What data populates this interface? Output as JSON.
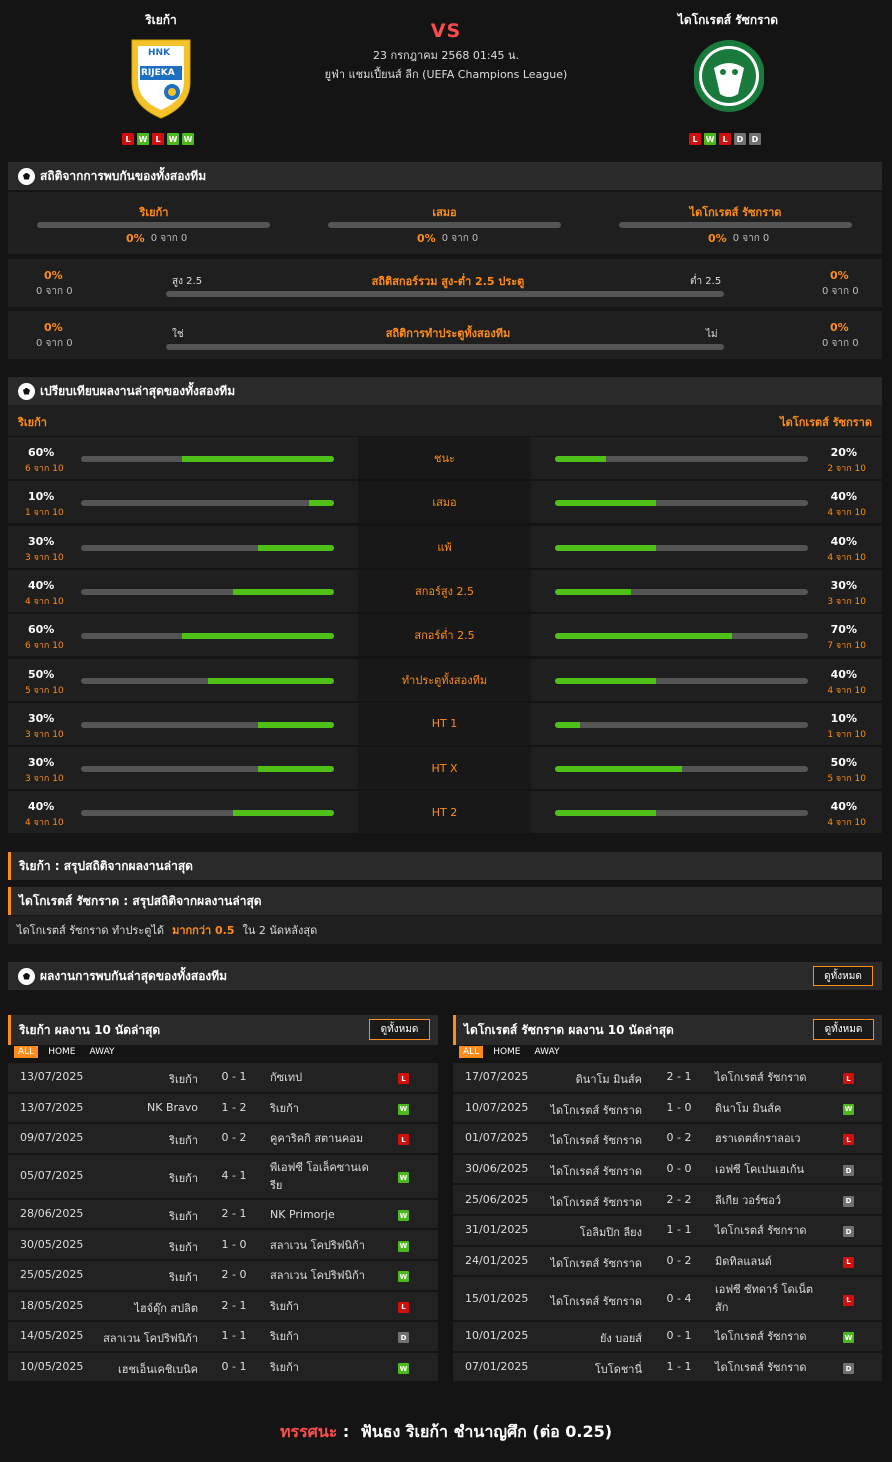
{
  "match": {
    "home": "ริเยก้า",
    "away": "ไดโกเรตส์ รัซกราด",
    "vs": "VS",
    "date": "23 กรกฎาคม 2568 01:45 น.",
    "league": "ยูฟ่า แชมเปี้ยนส์ ลีก (UEFA Champions League)",
    "home_logo_text": "RIJEKA",
    "home_logo_top": "HNK",
    "home_form": [
      "L",
      "W",
      "L",
      "W",
      "W"
    ],
    "away_form": [
      "L",
      "W",
      "L",
      "D",
      "D"
    ]
  },
  "h2h_stats": {
    "title": "สถิติจากการพบกันของทั้งสองทีม",
    "cols": [
      {
        "label": "ริเยก้า",
        "pct": "0%",
        "sub": "0 จาก 0"
      },
      {
        "label": "เสมอ",
        "pct": "0%",
        "sub": "0 จาก 0"
      },
      {
        "label": "ไดโกเรตส์ รัซกราด",
        "pct": "0%",
        "sub": "0 จาก 0"
      }
    ],
    "goals": {
      "label": "สถิติสกอร์รวม สูง-ต่ำ 2.5 ประตู",
      "left_pct": "0%",
      "left_sub": "0 จาก 0",
      "right_pct": "0%",
      "right_sub": "0 จาก 0",
      "left_tag": "สูง 2.5",
      "right_tag": "ต่ำ 2.5"
    },
    "btts": {
      "label": "สถิติการทำประตูทั้งสองทีม",
      "left_pct": "0%",
      "left_sub": "0 จาก 0",
      "right_pct": "0%",
      "right_sub": "0 จาก 0",
      "left_tag": "ใช่",
      "right_tag": "ไม่"
    }
  },
  "compare": {
    "title": "เปรียบเทียบผลงานล่าสุดของทั้งสองทีม",
    "home": "ริเยก้า",
    "away": "ไดโกเรตส์ รัซกราด",
    "rows": [
      {
        "label": "ชนะ",
        "lp": "60%",
        "ls": "6 จาก 10",
        "lv": 0.6,
        "rp": "20%",
        "rs": "2 จาก 10",
        "rv": 0.2
      },
      {
        "label": "เสมอ",
        "lp": "10%",
        "ls": "1 จาก 10",
        "lv": 0.1,
        "rp": "40%",
        "rs": "4 จาก 10",
        "rv": 0.4
      },
      {
        "label": "แพ้",
        "lp": "30%",
        "ls": "3 จาก 10",
        "lv": 0.3,
        "rp": "40%",
        "rs": "4 จาก 10",
        "rv": 0.4
      },
      {
        "label": "สกอร์สูง 2.5",
        "lp": "40%",
        "ls": "4 จาก 10",
        "lv": 0.4,
        "rp": "30%",
        "rs": "3 จาก 10",
        "rv": 0.3
      },
      {
        "label": "สกอร์ต่ำ 2.5",
        "lp": "60%",
        "ls": "6 จาก 10",
        "lv": 0.6,
        "rp": "70%",
        "rs": "7 จาก 10",
        "rv": 0.7
      },
      {
        "label": "ทำประตูทั้งสองทีม",
        "lp": "50%",
        "ls": "5 จาก 10",
        "lv": 0.5,
        "rp": "40%",
        "rs": "4 จาก 10",
        "rv": 0.4
      },
      {
        "label": "HT 1",
        "lp": "30%",
        "ls": "3 จาก 10",
        "lv": 0.3,
        "rp": "10%",
        "rs": "1 จาก 10",
        "rv": 0.1
      },
      {
        "label": "HT X",
        "lp": "30%",
        "ls": "3 จาก 10",
        "lv": 0.3,
        "rp": "50%",
        "rs": "5 จาก 10",
        "rv": 0.5
      },
      {
        "label": "HT 2",
        "lp": "40%",
        "ls": "4 จาก 10",
        "lv": 0.4,
        "rp": "40%",
        "rs": "4 จาก 10",
        "rv": 0.4
      }
    ]
  },
  "summary": {
    "home_title": "ริเยก้า : สรุปสถิติจากผลงานล่าสุด",
    "away_title": "ไดโกเรตส์ รัซกราด : สรุปสถิติจากผลงานล่าสุด",
    "away_line_a": "ไดโกเรตส์ รัซกราด  ทำประตูได้",
    "away_line_b": "มากกว่า  0.5",
    "away_line_c": "ใน 2 นัดหลังสุด"
  },
  "recent": {
    "title": "ผลงานการพบกันล่าสุดของทั้งสองทีม",
    "view_all": "ดูทั้งหมด",
    "tabs": [
      "ALL",
      "HOME",
      "AWAY"
    ],
    "home_title": "ริเยก้า ผลงาน 10 นัดล่าสุด",
    "away_title": "ไดโกเรตส์ รัซกราด ผลงาน 10 นัดล่าสุด",
    "home_matches": [
      {
        "date": "13/07/2025",
        "home": "ริเยก้า",
        "score": "0 - 1",
        "away": "กัซเทป",
        "res": "L"
      },
      {
        "date": "13/07/2025",
        "home": "NK Bravo",
        "score": "1 - 2",
        "away": "ริเยก้า",
        "res": "W"
      },
      {
        "date": "09/07/2025",
        "home": "ริเยก้า",
        "score": "0 - 2",
        "away": "คูคาริคกิ สตานคอม",
        "res": "L"
      },
      {
        "date": "05/07/2025",
        "home": "ริเยก้า",
        "score": "4 - 1",
        "away": "พีเอฟซี โอเล็คซานเดรีย",
        "res": "W"
      },
      {
        "date": "28/06/2025",
        "home": "ริเยก้า",
        "score": "2 - 1",
        "away": "NK Primorje",
        "res": "W"
      },
      {
        "date": "30/05/2025",
        "home": "ริเยก้า",
        "score": "1 - 0",
        "away": "สลาเวน โคปริฟนิก้า",
        "res": "W"
      },
      {
        "date": "25/05/2025",
        "home": "ริเยก้า",
        "score": "2 - 0",
        "away": "สลาเวน โคปริฟนิก้า",
        "res": "W"
      },
      {
        "date": "18/05/2025",
        "home": "ไฮจ์ดุ๊ก สปลิต",
        "score": "2 - 1",
        "away": "ริเยก้า",
        "res": "L"
      },
      {
        "date": "14/05/2025",
        "home": "สลาเวน โคปริฟนิก้า",
        "score": "1 - 1",
        "away": "ริเยก้า",
        "res": "D"
      },
      {
        "date": "10/05/2025",
        "home": "เฮชเอ็นเคชิเบนิค",
        "score": "0 - 1",
        "away": "ริเยก้า",
        "res": "W"
      }
    ],
    "away_matches": [
      {
        "date": "17/07/2025",
        "home": "ดินาโม มินส์ค",
        "score": "2 - 1",
        "away": "ไดโกเรตส์ รัซกราด",
        "res": "L"
      },
      {
        "date": "10/07/2025",
        "home": "ไดโกเรตส์ รัซกราด",
        "score": "1 - 0",
        "away": "ดินาโม มินส์ค",
        "res": "W"
      },
      {
        "date": "01/07/2025",
        "home": "ไดโกเรตส์ รัซกราด",
        "score": "0 - 2",
        "away": "ฮราเดตส์กราลอเว",
        "res": "L"
      },
      {
        "date": "30/06/2025",
        "home": "ไดโกเรตส์ รัซกราด",
        "score": "0 - 0",
        "away": "เอฟซี โคเปนเฮเก้น",
        "res": "D"
      },
      {
        "date": "25/06/2025",
        "home": "ไดโกเรตส์ รัซกราด",
        "score": "2 - 2",
        "away": "ลีเกีย วอร์ซอว์",
        "res": "D"
      },
      {
        "date": "31/01/2025",
        "home": "โอลิมปิก ลียง",
        "score": "1 - 1",
        "away": "ไดโกเรตส์ รัซกราด",
        "res": "D"
      },
      {
        "date": "24/01/2025",
        "home": "ไดโกเรตส์ รัซกราด",
        "score": "0 - 2",
        "away": "มิดทิลแลนด์",
        "res": "L"
      },
      {
        "date": "15/01/2025",
        "home": "ไดโกเรตส์ รัซกราด",
        "score": "0 - 4",
        "away": "เอฟซี ซัทดาร์ โดเน็ตสัก",
        "res": "L"
      },
      {
        "date": "10/01/2025",
        "home": "ยัง บอยส์",
        "score": "0 - 1",
        "away": "ไดโกเรตส์ รัซกราด",
        "res": "W"
      },
      {
        "date": "07/01/2025",
        "home": "โบโดชานี่",
        "score": "1 - 1",
        "away": "ไดโกเรตส์ รัซกราด",
        "res": "D"
      }
    ]
  },
  "verdict": {
    "label": "ทรรศนะ",
    "sep": " :  ",
    "text": "ฟันธง ริเยก้า ชำนาญศึก (ต่อ 0.25)"
  },
  "colors": {
    "accent": "#ff8c1a",
    "win": "#4db81c",
    "loss": "#d10f0f",
    "draw": "#707070",
    "bar_fill": "#4ec018"
  }
}
